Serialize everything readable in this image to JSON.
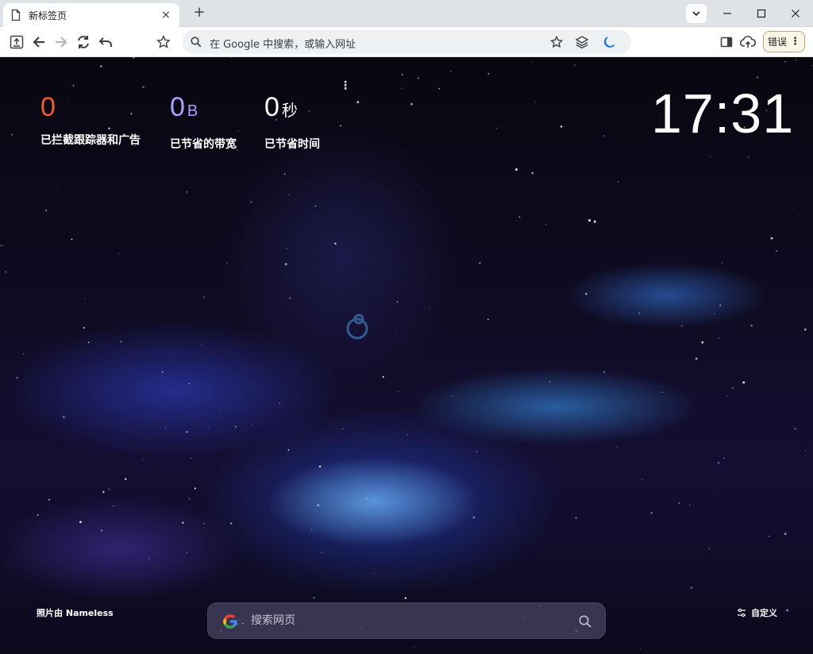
{
  "tab": {
    "title": "新标签页",
    "close_icon": "×"
  },
  "new_tab_icon": "+",
  "window_controls": {
    "minimize": "—",
    "maximize": "☐",
    "close": "✕"
  },
  "omnibox": {
    "placeholder": "在 Google 中搜索，或输入网址"
  },
  "error_button": {
    "label": "错误",
    "menu": "⋮"
  },
  "stats": {
    "trackers": {
      "value": "0",
      "unit": "",
      "label": "已拦截跟踪器和广告",
      "color": "#f15a30"
    },
    "bandwidth": {
      "value": "0",
      "unit": "B",
      "label": "已节省的带宽",
      "color": "#a9a2ff"
    },
    "time": {
      "value": "0",
      "unit": "秒",
      "label": "已节省时间",
      "color": "#ffffff"
    }
  },
  "stats_menu": "⋮",
  "clock": "17:31",
  "photo_credit": "照片由 Nameless",
  "customize_label": "自定义",
  "search": {
    "placeholder": "搜索网页"
  },
  "colors": {
    "brand_orange": "#f15a30",
    "accent_purple": "#a9a2ff"
  }
}
